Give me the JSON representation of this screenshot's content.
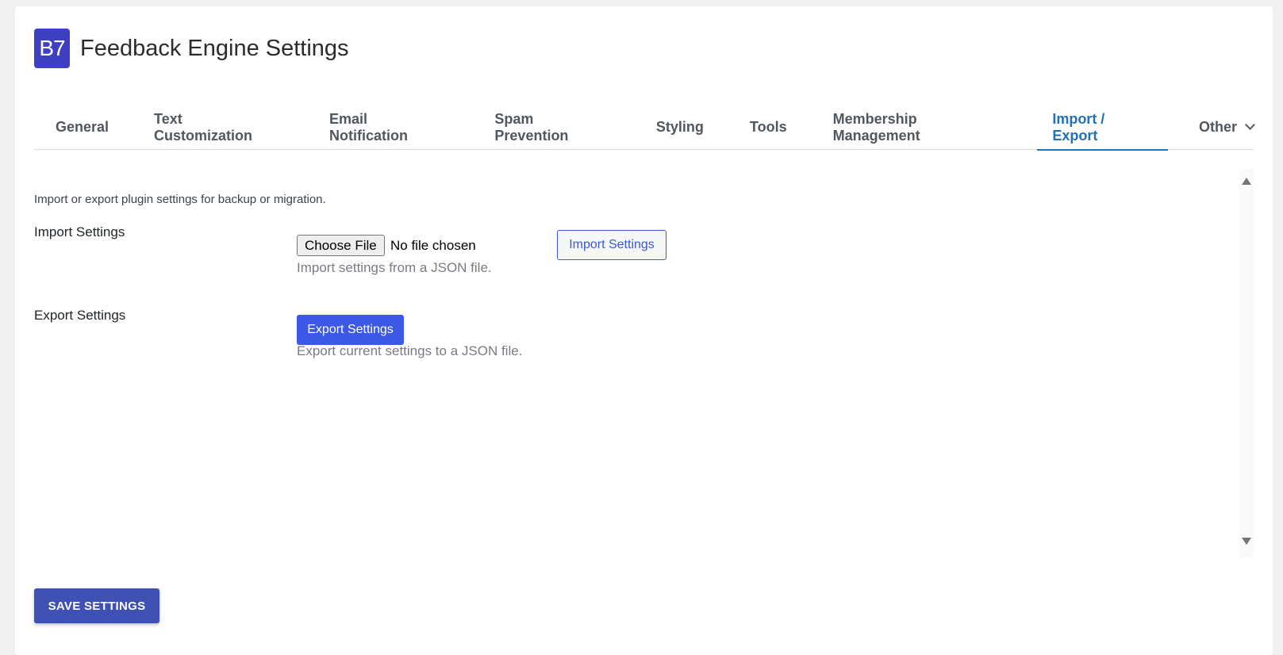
{
  "header": {
    "logo_text": "B7",
    "title": "Feedback Engine Settings"
  },
  "tabs": [
    {
      "label": "General",
      "active": false
    },
    {
      "label": "Text Customization",
      "active": false
    },
    {
      "label": "Email Notification",
      "active": false
    },
    {
      "label": "Spam Prevention",
      "active": false
    },
    {
      "label": "Styling",
      "active": false
    },
    {
      "label": "Tools",
      "active": false
    },
    {
      "label": "Membership Management",
      "active": false
    },
    {
      "label": "Import / Export",
      "active": true
    },
    {
      "label": "Other",
      "active": false,
      "has_dropdown": true
    }
  ],
  "content": {
    "intro": "Import or export plugin settings for backup or migration.",
    "import": {
      "label": "Import Settings",
      "choose_file_label": "Choose File",
      "file_status": "No file chosen",
      "button_label": "Import Settings",
      "description": "Import settings from a JSON file."
    },
    "export": {
      "label": "Export Settings",
      "button_label": "Export Settings",
      "description": "Export current settings to a JSON file."
    }
  },
  "footer": {
    "save_label": "SAVE SETTINGS"
  },
  "colors": {
    "accent": "#2271b1",
    "primary_button": "#3b58e6",
    "save_button": "#3f51b5",
    "logo_bg": "#3f3fc2"
  }
}
